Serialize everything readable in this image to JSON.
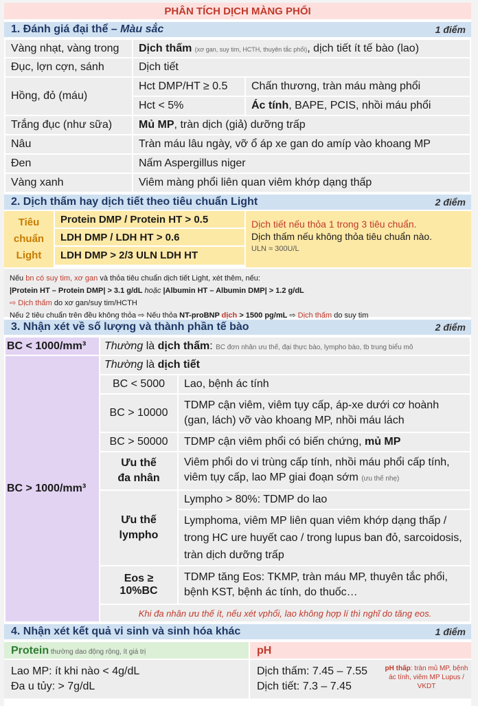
{
  "title": "PHÂN TÍCH DỊCH MÀNG PHỔI",
  "s1": {
    "heading": "1.  Đánh giá đại thể – Màu sắc",
    "heading_a": "1.  Đánh giá đại thể – ",
    "heading_b": "Màu sắc",
    "points": "1 điểm",
    "r1a": "Vàng nhạt, vàng trong",
    "r1b": "Dịch thấm",
    "r1c": "(xơ gan, suy tim, HCTH, thuyên tắc phổi)",
    "r1d": ", dịch tiết ít tế bào (lao)",
    "r2a": "Đục, lợn cợn, sánh",
    "r2b": "Dịch tiết",
    "r3a": "Hồng, đỏ (máu)",
    "r3b": "Hct DMP/HT ≥ 0.5",
    "r3c": "Chấn thương, tràn máu màng phổi",
    "r3d": "Hct < 5%",
    "r3e": "Ác tính",
    "r3f": ", BAPE, PCIS, nhồi máu phổi",
    "r4a": "Trắng đục (như sữa)",
    "r4b": "Mủ MP",
    "r4c": ", tràn dịch (giả) dưỡng trấp",
    "r5a": "Nâu",
    "r5b": "Tràn máu lâu ngày, vỡ ổ áp xe gan do amíp vào khoang MP",
    "r6a": "Đen",
    "r6b": "Nấm Aspergillus niger",
    "r7a": "Vàng xanh",
    "r7b": "Viêm màng phổi liên quan viêm khớp dạng thấp"
  },
  "s2": {
    "heading": "2.  Dịch thấm hay dịch tiết theo tiêu chuẩn Light",
    "points": "2 điểm",
    "label1": "Tiêu",
    "label2": "chuẩn",
    "label3": "Light",
    "c1": "Protein DMP / Protein HT > 0.5",
    "c2": "LDH DMP / LDH HT > 0.6",
    "c3": "LDH DMP > 2/3 ULN LDH HT",
    "res1": "Dịch tiết nếu thỏa 1 trong 3 tiêu chuẩn.",
    "res2": "Dịch thấm nếu không thỏa tiêu chuẩn nào.",
    "res3": "ULN ≈ 300U/L",
    "n1a": "Nếu ",
    "n1b": "bn có suy tim, xơ gan",
    "n1c": " và thỏa tiêu chuẩn dịch tiết Light, xét thêm, nếu:",
    "n2": "|Protein HT – Protein DMP| > 3.1 g/dL",
    "n2b": " hoặc ",
    "n2c": "|Albumin HT – Albumin DMP| > 1.2 g/dL",
    "n3a": "⇨ ",
    "n3b": "Dịch thấm",
    "n3c": " do xơ gan/suy tim/HCTH",
    "n4a": "Nếu 2 tiêu chuẩn trên đều không thỏa ⇨ Nếu thỏa ",
    "n4b": "NT-proBNP",
    "n4c": " dịch",
    "n4d": " > 1500 pg/mL",
    "n4e": " ⇨ ",
    "n4f": "Dịch thấm",
    "n4g": " do suy tim"
  },
  "s3": {
    "heading": "3.  Nhận xét về số lượng và thành phần tế bào",
    "points": "2 điểm",
    "bc_low": "BC < 1000/mm³",
    "bc_low_a": "Thường",
    "bc_low_b": " là ",
    "bc_low_c": "dịch thấm",
    "bc_low_d": ": ",
    "bc_low_e": "BC đơn nhân ưu thế, đại thực bào, lympho bào, tb trung biểu mô",
    "bc_high": "BC > 1000/mm³",
    "tiet_a": "Thường",
    "tiet_b": " là ",
    "tiet_c": "dịch tiết",
    "k1": "BC < 5000",
    "v1": "Lao, bệnh ác tính",
    "k2": "BC > 10000",
    "v2": "TDMP cận viêm, viêm tụy cấp, áp-xe dưới cơ hoành (gan, lách) vỡ vào khoang MP, nhồi máu lách",
    "k3": "BC > 50000",
    "v3": "TDMP cận viêm phổi có biến chứng, ",
    "v3b": "mủ MP",
    "k4a": "Ưu thế",
    "k4b": "đa nhân",
    "v4": "Viêm phổi do vi trùng cấp tính, nhồi máu phổi cấp tính, viêm tụy cấp, lao MP giai đoạn sớm ",
    "v4b": "(ưu thế nhẹ)",
    "k5a": "Ưu thế",
    "k5b": "lympho",
    "v5a": "Lympho > 80%: TDMP do lao",
    "v5b": "Lymphoma, viêm MP liên quan viêm khớp dạng thấp / trong HC ure huyết cao / trong lupus ban đỏ, sarcoidosis, tràn dịch dưỡng trấp",
    "k6": "Eos ≥ 10%BC",
    "v6": "TDMP tăng Eos: TKMP, tràn máu MP, thuyên tắc phổi, bệnh KST, bệnh ác tính, do thuốc…",
    "note": "Khi đa nhân ưu thế ít, nếu xét vphổi, lao không hợp lí thì nghĩ do tăng eos."
  },
  "s4": {
    "heading": "4.  Nhận xét kết quả vi sinh và sinh hóa khác",
    "points": "1 điểm",
    "prot_h": "Protein",
    "prot_sub": " thường dao động rộng, ít giá trị",
    "p1": "Lao MP: ít khi nào < 4g/dL",
    "p2": "Đa u tủy: > 7g/dL",
    "ph_h": "pH",
    "ph1": "Dịch thấm: 7.45 – 7.55",
    "ph2": "Dịch tiết: 7.3 – 7.45",
    "ph_note_a": "pH thấp",
    "ph_note_b": ": tràn mủ MP, bệnh ác tính, viêm MP Lupus / VKDT"
  },
  "colors": {
    "title_bg": "#fde0de",
    "section_bg": "#cfe0f1",
    "light_bg": "#fde9a6",
    "purple": "#e2d3f3",
    "green_bg": "#dcefd7",
    "red": "#c0392b"
  }
}
